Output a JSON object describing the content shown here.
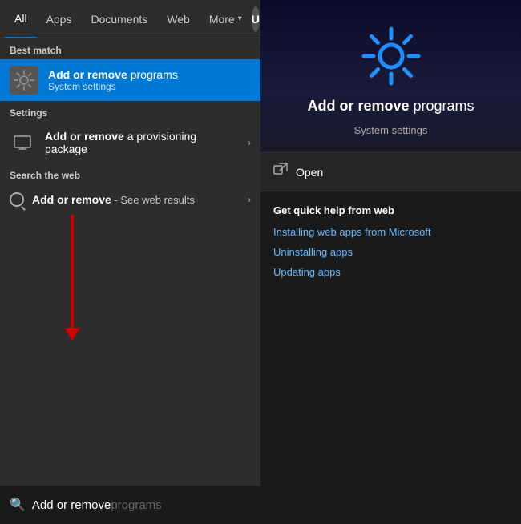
{
  "nav": {
    "tabs": [
      {
        "id": "all",
        "label": "All",
        "active": true
      },
      {
        "id": "apps",
        "label": "Apps",
        "active": false
      },
      {
        "id": "documents",
        "label": "Documents",
        "active": false
      },
      {
        "id": "web",
        "label": "Web",
        "active": false
      },
      {
        "id": "more",
        "label": "More",
        "active": false
      }
    ],
    "user_avatar": "U"
  },
  "sections": {
    "best_match_label": "Best match",
    "settings_label": "Settings",
    "web_search_label": "Search the web"
  },
  "best_match": {
    "title_plain": "Add or remove",
    "title_bold": "programs",
    "subtitle": "System settings"
  },
  "settings_items": [
    {
      "title_bold": "Add or remove",
      "title_plain": " a provisioning package",
      "has_arrow": true
    }
  ],
  "web_items": [
    {
      "title_bold": "Add or remove",
      "title_suffix": " - See web results",
      "has_arrow": true
    }
  ],
  "search_bar": {
    "typed": "Add or remove",
    "placeholder": "programs"
  },
  "right_panel": {
    "app_title_bold": "Add or remove",
    "app_title_plain": " programs",
    "app_subtitle": "System settings",
    "open_label": "Open",
    "quick_help_title": "Get quick help from web",
    "help_links": [
      "Installing web apps from Microsoft",
      "Uninstalling apps",
      "Updating apps"
    ]
  },
  "taskbar": {
    "icons": [
      "⊞",
      "⊡",
      "✉",
      "📱",
      "📁",
      "🌐",
      "🌐"
    ]
  },
  "colors": {
    "accent": "#0078d4",
    "gear_color": "#1e90ff",
    "selected_bg": "#0078d4",
    "panel_bg": "#2d2d2d",
    "right_bg": "#1a1a1a"
  }
}
